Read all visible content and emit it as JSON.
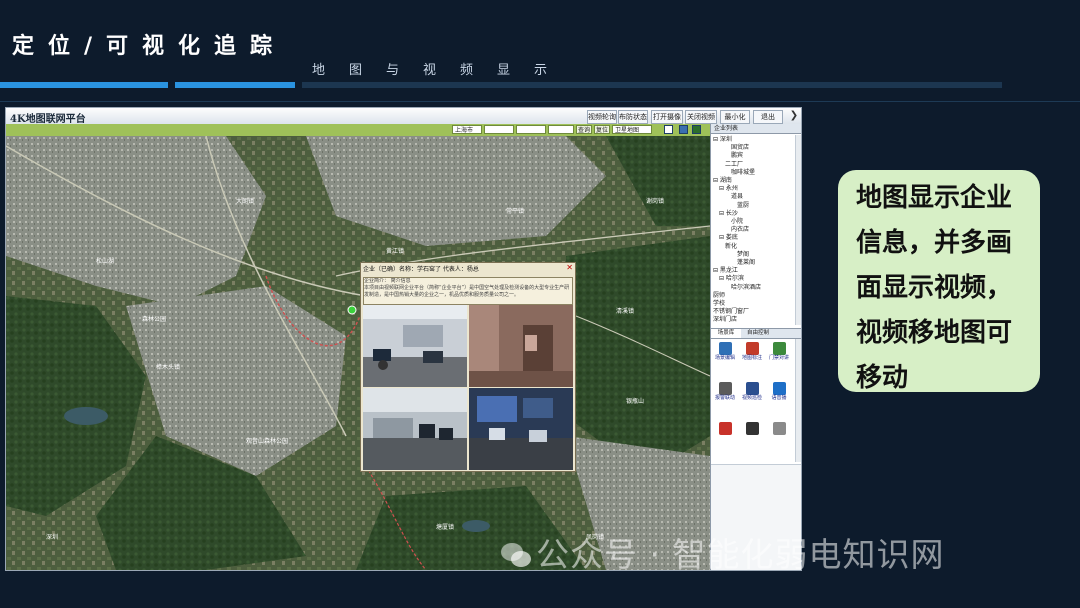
{
  "slide": {
    "title": "定位/可视化追踪",
    "subtitle": "地图与视频显示"
  },
  "app": {
    "title": "4K地图联网平台",
    "toolbar": {
      "buttons": [
        "视频轮询",
        "布防状态",
        "打开摄像",
        "关闭视频",
        "最小化",
        "退出"
      ]
    },
    "subbar": {
      "city_select": "上海市",
      "district_select": "",
      "street_select": "",
      "poi_select": "",
      "search_label": "查询",
      "reset_label": "复位",
      "layer_select": "卫星地图"
    },
    "map": {
      "labels": [
        "森林公园",
        "观音山森林公园",
        "清溪镇",
        "银瓶山",
        "凤岗镇",
        "塘厦镇",
        "樟木头镇",
        "谢岗镇",
        "大朗镇",
        "黄江镇",
        "松山湖",
        "常平镇",
        "深圳"
      ]
    },
    "popup": {
      "header": "企业（已确）名称：学石窑了      代表人：杨总",
      "close": "✕",
      "info_label": "企业简介：",
      "info_title": "简介信息",
      "info_body": "本项目由视频联网企业平台（简称“企业平台”）是中国空气处理及检测设备的大型专业生产研发制造，是中国热销大量的企业之一，机品优质和服务质量公司之一。"
    },
    "sidebar": {
      "header": "企业列表",
      "tree": [
        {
          "text": "⊟ 深圳",
          "indent": 0
        },
        {
          "text": "国贸店",
          "indent": 3
        },
        {
          "text": "鹏宾",
          "indent": 3
        },
        {
          "text": "二工厂",
          "indent": 2
        },
        {
          "text": "咖啡城堡",
          "indent": 3
        },
        {
          "text": "⊟ 湖南",
          "indent": 0
        },
        {
          "text": "⊟ 永州",
          "indent": 1
        },
        {
          "text": "道县",
          "indent": 3
        },
        {
          "text": "蓝厨",
          "indent": 4
        },
        {
          "text": "⊟ 长沙",
          "indent": 1
        },
        {
          "text": "小院",
          "indent": 3
        },
        {
          "text": "内衣店",
          "indent": 3
        },
        {
          "text": "⊟ 娄底",
          "indent": 1
        },
        {
          "text": "新化",
          "indent": 2
        },
        {
          "text": "梦阁",
          "indent": 4
        },
        {
          "text": "蓬莱阁",
          "indent": 4
        },
        {
          "text": "⊟ 黑龙江",
          "indent": 0
        },
        {
          "text": "⊟ 哈尔滨",
          "indent": 1
        },
        {
          "text": "哈尔滨酒店",
          "indent": 3
        },
        {
          "text": "厨师",
          "indent": 0
        },
        {
          "text": "学校",
          "indent": 0
        },
        {
          "text": "不锈钢门窗厂",
          "indent": 0
        },
        {
          "text": "深圳门店",
          "indent": 0
        }
      ],
      "tabs": [
        "场景库",
        "自由控制"
      ],
      "tools": [
        {
          "label": "场景编辑",
          "color": "#2f6fb5",
          "icon": "scene-icon"
        },
        {
          "label": "地图标注",
          "color": "#c23b2a",
          "icon": "map-marker-icon"
        },
        {
          "label": "门禁对讲",
          "color": "#3c8a3c",
          "icon": "intercom-icon"
        },
        {
          "label": "报警联动",
          "color": "#5b5b5b",
          "icon": "alarm-icon"
        },
        {
          "label": "视频巡检",
          "color": "#2b4f8f",
          "icon": "camera-icon"
        },
        {
          "label": "语音播",
          "color": "#1e6fc7",
          "icon": "speaker-icon"
        },
        {
          "label": "",
          "color": "#c8322a",
          "icon": "siren-icon"
        },
        {
          "label": "",
          "color": "#333333",
          "icon": "speaker-box-icon"
        },
        {
          "label": "",
          "color": "#8a8a8a",
          "icon": "dome-camera-icon"
        }
      ]
    }
  },
  "callout": {
    "lines": [
      "地图显示企业",
      "信息，并多画",
      "面显示视频，",
      "视频移地图可",
      "移动"
    ]
  },
  "watermark": {
    "text": "公众号 · 智能化弱电知识网"
  }
}
